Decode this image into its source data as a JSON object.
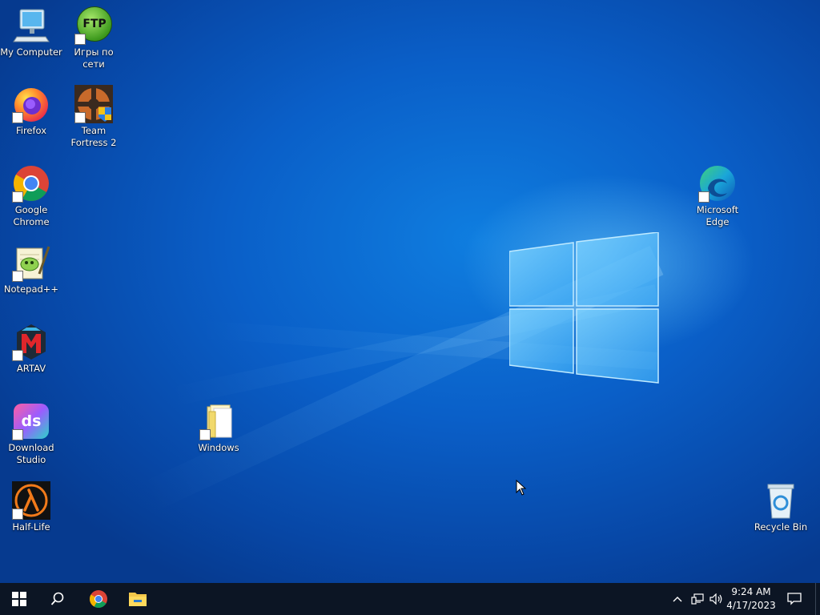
{
  "desktop": {
    "icons": {
      "my_computer": "My Computer",
      "ftp_games": "Игры по сети",
      "ftp_badge": "FTP",
      "firefox": "Firefox",
      "team_fortress": "Team Fortress 2",
      "chrome": "Google Chrome",
      "notepadpp": "Notepad++",
      "artav": "ARTAV",
      "download_studio": "Download Studio",
      "download_studio_badge": "ds",
      "half_life": "Half-Life",
      "windows_folder": "Windows",
      "edge": "Microsoft Edge",
      "recycle_bin": "Recycle Bin"
    }
  },
  "taskbar": {
    "pinned": [
      "start-icon",
      "search-icon",
      "chrome-icon",
      "file-explorer-icon"
    ],
    "clock": {
      "time": "9:24 AM",
      "date": "4/17/2023"
    }
  },
  "colors": {
    "taskbar_bg": "#0c1524",
    "desktop_accent": "#0a5fc8"
  }
}
